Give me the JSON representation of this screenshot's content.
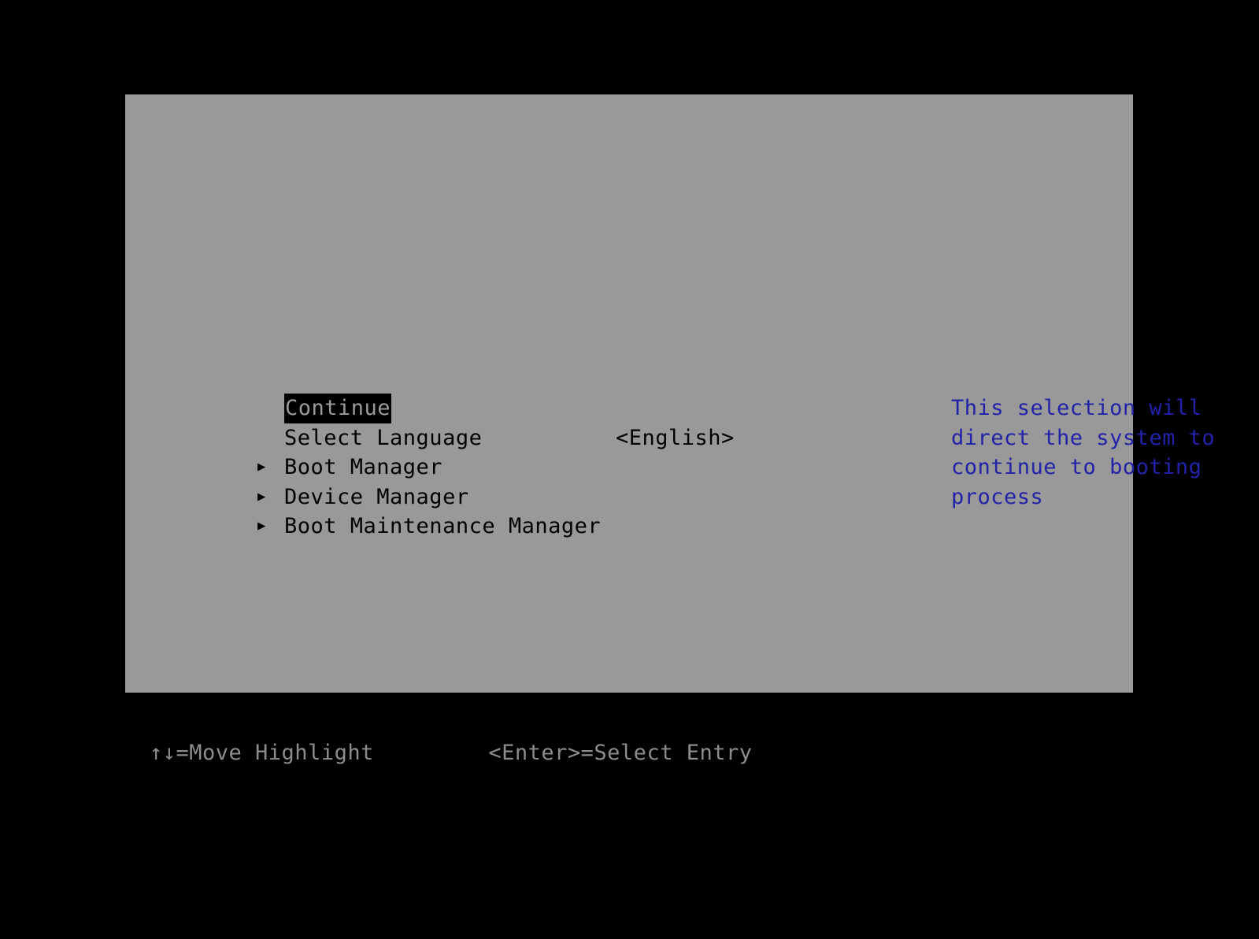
{
  "colors": {
    "screen_background": "#000000",
    "panel_background": "#999999",
    "menu_text": "#000000",
    "selected_background": "#000000",
    "selected_text": "#9a9a9a",
    "help_text": "#2222a8",
    "footer_text": "#8d8d8d"
  },
  "menu": {
    "items": [
      {
        "label": "Continue",
        "value": "",
        "arrow": "",
        "selected": true,
        "has_submenu": false
      },
      {
        "label": "Select Language",
        "value": "<English>",
        "arrow": "",
        "selected": false,
        "has_submenu": false
      },
      {
        "label": "Boot Manager",
        "value": "",
        "arrow": "▶",
        "selected": false,
        "has_submenu": true
      },
      {
        "label": "Device Manager",
        "value": "",
        "arrow": "▶",
        "selected": false,
        "has_submenu": true
      },
      {
        "label": "Boot Maintenance Manager",
        "value": "",
        "arrow": "▶",
        "selected": false,
        "has_submenu": true
      }
    ]
  },
  "help": {
    "lines": [
      "This selection will",
      "direct the system to",
      "continue to booting",
      "process"
    ]
  },
  "footer": {
    "hints": [
      "↑↓=Move Highlight",
      "<Enter>=Select Entry"
    ]
  }
}
